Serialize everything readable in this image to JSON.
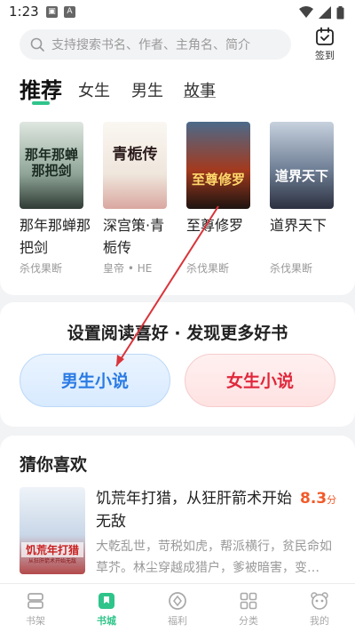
{
  "status_bar": {
    "time": "1:23",
    "notif_a": "A"
  },
  "search": {
    "placeholder": "支持搜索书名、作者、主角名、简介"
  },
  "sign_in": {
    "label": "签到"
  },
  "tabs": [
    {
      "label": "推荐",
      "active": true
    },
    {
      "label": "女生"
    },
    {
      "label": "男生"
    },
    {
      "label": "故事"
    }
  ],
  "books": [
    {
      "title": "那年那蝉那把剑",
      "author": "杀伐果断",
      "cover_text": "那年那蝉那把剑",
      "cover_color": "#bcc9c0"
    },
    {
      "title": "深宫策·青栀传",
      "author": "皇帝 • HE",
      "cover_text": "青栀传",
      "cover_color": "#f1ede6"
    },
    {
      "title": "至尊修罗",
      "author": "杀伐果断",
      "cover_text": "至尊修罗",
      "cover_color": "#3b2a22"
    },
    {
      "title": "道界天下",
      "author": "杀伐果断",
      "cover_text": "道界天下",
      "cover_color": "#8a97a8"
    }
  ],
  "preference": {
    "title": "设置阅读喜好 · 发现更多好书",
    "male_label": "男生小说",
    "female_label": "女生小说"
  },
  "guess": {
    "section_title": "猜你喜欢",
    "book": {
      "title": "饥荒年打猎，从狂肝箭术开始无敌",
      "score": "8.3",
      "score_unit": "分",
      "description": "大乾乱世，苛税如虎，帮派横行，贫民命如草芥。林尘穿越成猎户，爹被暗害，变…",
      "cover_text": "饥荒年打猎",
      "cover_subtext": "从狂肝箭术开始无敌"
    }
  },
  "bottom_nav": [
    {
      "label": "书架"
    },
    {
      "label": "书城",
      "active": true
    },
    {
      "label": "福利"
    },
    {
      "label": "分类"
    },
    {
      "label": "我的"
    }
  ],
  "colors": {
    "accent": "#2fc48a",
    "male": "#2a7be4",
    "female": "#e0283c",
    "score": "#f15a29",
    "annotation_arrow": "#d9343a"
  }
}
